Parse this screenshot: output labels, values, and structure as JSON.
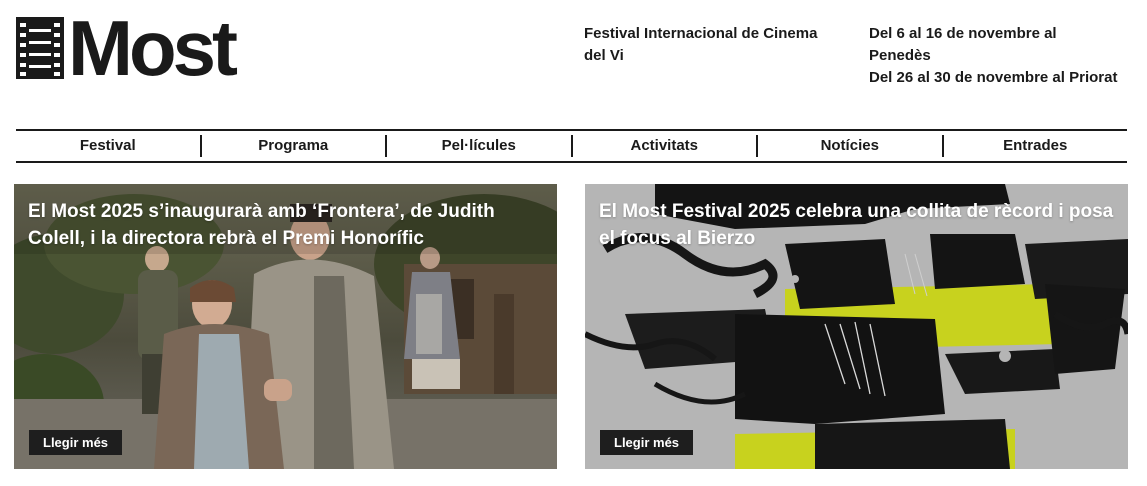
{
  "header": {
    "logo_text": "Most",
    "subtitle": "Festival Internacional de Cinema del Vi",
    "dates": [
      "Del 6 al 16 de novembre al Penedès",
      "Del 26 al 30 de novembre al Priorat"
    ]
  },
  "nav": {
    "items": [
      {
        "label": "Festival"
      },
      {
        "label": "Programa"
      },
      {
        "label": "Pel·lícules"
      },
      {
        "label": "Activitats"
      },
      {
        "label": "Notícies"
      },
      {
        "label": "Entrades"
      }
    ]
  },
  "cards": [
    {
      "title": "El Most 2025 s’inaugurarà amb ‘Frontera’, de Judith Colell, i la directora rebrà el Premi Honorífic",
      "button": "Llegir més"
    },
    {
      "title": "El Most Festival 2025 celebra una collita de rècord i posa el focus al Bierzo",
      "button": "Llegir més"
    }
  ],
  "colors": {
    "text": "#1a1a1a",
    "accent": "#c8d21e",
    "button_bg": "#1e1e1e",
    "right_card_bg": "#b5b5b5"
  }
}
